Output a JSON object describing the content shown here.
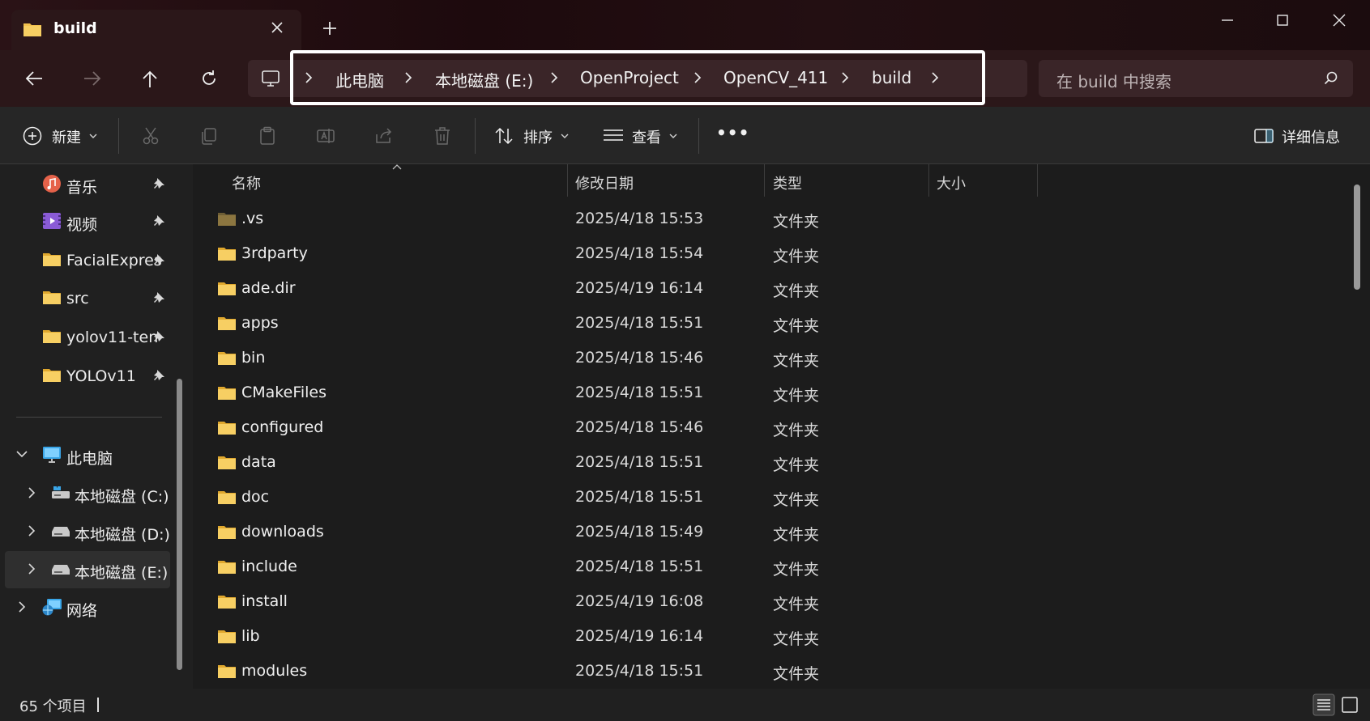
{
  "window": {
    "tab_title": "build",
    "new_tab_symbol": "+",
    "buttons": [
      "minimize-icon",
      "maximize-icon",
      "close-icon"
    ]
  },
  "nav": {
    "buttons": [
      "back-arrow-icon",
      "forward-arrow-icon",
      "up-arrow-icon",
      "refresh-icon",
      "this-pc-icon"
    ],
    "breadcrumb": [
      "此电脑",
      "本地磁盘 (E:)",
      "OpenProject",
      "OpenCV_411",
      "build"
    ],
    "search_placeholder": "在 build 中搜索"
  },
  "toolbar": {
    "new_label": "新建",
    "sort_label": "排序",
    "view_label": "查看",
    "more_label": "•••",
    "details_label": "详细信息"
  },
  "sidebar": {
    "pinned": [
      {
        "label": "音乐",
        "icon": "music-icon"
      },
      {
        "label": "视频",
        "icon": "video-icon"
      },
      {
        "label": "FacialExpres",
        "icon": "folder-icon"
      },
      {
        "label": "src",
        "icon": "folder-icon"
      },
      {
        "label": "yolov11-ten",
        "icon": "folder-icon"
      },
      {
        "label": "YOLOv11",
        "icon": "folder-icon"
      }
    ],
    "this_pc": "此电脑",
    "drives": [
      "本地磁盘 (C:)",
      "本地磁盘 (D:)",
      "本地磁盘 (E:)"
    ],
    "network": "网络"
  },
  "columns": {
    "name": "名称",
    "date": "修改日期",
    "type": "类型",
    "size": "大小"
  },
  "files": [
    {
      "name": ".vs",
      "date": "2025/4/18 15:53",
      "type": "文件夹"
    },
    {
      "name": "3rdparty",
      "date": "2025/4/18 15:54",
      "type": "文件夹"
    },
    {
      "name": "ade.dir",
      "date": "2025/4/19 16:14",
      "type": "文件夹"
    },
    {
      "name": "apps",
      "date": "2025/4/18 15:51",
      "type": "文件夹"
    },
    {
      "name": "bin",
      "date": "2025/4/18 15:46",
      "type": "文件夹"
    },
    {
      "name": "CMakeFiles",
      "date": "2025/4/18 15:51",
      "type": "文件夹"
    },
    {
      "name": "configured",
      "date": "2025/4/18 15:46",
      "type": "文件夹"
    },
    {
      "name": "data",
      "date": "2025/4/18 15:51",
      "type": "文件夹"
    },
    {
      "name": "doc",
      "date": "2025/4/18 15:51",
      "type": "文件夹"
    },
    {
      "name": "downloads",
      "date": "2025/4/18 15:49",
      "type": "文件夹"
    },
    {
      "name": "include",
      "date": "2025/4/18 15:51",
      "type": "文件夹"
    },
    {
      "name": "install",
      "date": "2025/4/19 16:08",
      "type": "文件夹"
    },
    {
      "name": "lib",
      "date": "2025/4/19 16:14",
      "type": "文件夹"
    },
    {
      "name": "modules",
      "date": "2025/4/18 15:51",
      "type": "文件夹"
    }
  ],
  "status": {
    "item_count": "65 个项目"
  },
  "colors": {
    "folder": "#f2c14e",
    "folder_hidden": "#8c7640",
    "accent": "#60cdff"
  }
}
